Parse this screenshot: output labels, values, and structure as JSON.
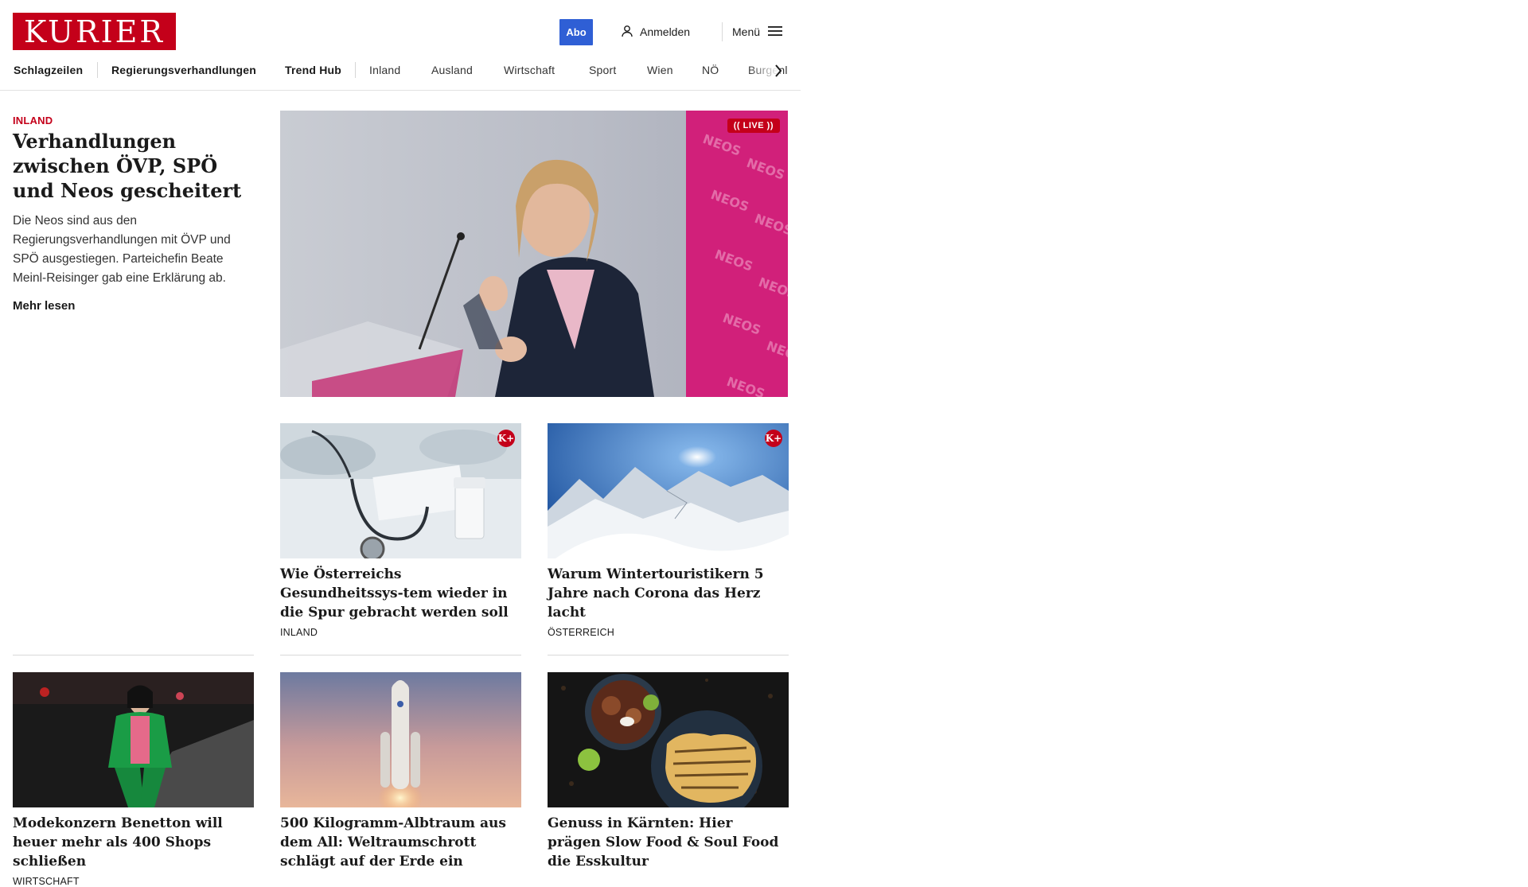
{
  "brand": {
    "logo_text": "KURIER",
    "brand_color": "#c4001a",
    "accent_color": "#2f5fd5"
  },
  "header": {
    "abo_label": "Abo",
    "login_label": "Anmelden",
    "login_icon": "user-icon",
    "menu_label": "Menü",
    "menu_icon": "hamburger-icon"
  },
  "nav": {
    "items": [
      {
        "label": "Schlagzeilen"
      },
      {
        "label": "Regierungsverhandlungen"
      },
      {
        "label": "Trend Hub"
      },
      {
        "label": "Inland"
      },
      {
        "label": "Ausland"
      },
      {
        "label": "Wirtschaft"
      },
      {
        "label": "Sport"
      },
      {
        "label": "Wien"
      },
      {
        "label": "NÖ"
      },
      {
        "label": "Burgenland"
      }
    ],
    "next_icon": "chevron-right-icon"
  },
  "lead": {
    "category": "INLAND",
    "title": "Verhandlungen zwischen ÖVP, SPÖ und Neos gescheitert",
    "teaser": "Die Neos sind aus den Regierungsverhandlungen mit ÖVP und SPÖ ausgestiegen. Parteichefin Beate Meinl-Reisinger gab eine Erklärung ab.",
    "more_label": "Mehr lesen",
    "live_label": "LIVE"
  },
  "cards": [
    {
      "title": "Wie Österreichs Gesundheitssys-tem wieder in die Spur gebracht werden soll",
      "category": "INLAND",
      "premium": "K+"
    },
    {
      "title": "Warum Wintertouristikern 5 Jahre nach Corona das Herz lacht",
      "category": "ÖSTERREICH",
      "premium": "K+"
    },
    {
      "title": "Modekonzern Benetton will heuer mehr als 400 Shops schließen",
      "category": "WIRTSCHAFT"
    },
    {
      "title": "500 Kilogramm-Albtraum aus dem All: Weltraumschrott schlägt auf der Erde ein",
      "category": ""
    },
    {
      "title": "Genuss in Kärnten: Hier prägen Slow Food & Soul Food die Esskultur",
      "category": ""
    }
  ]
}
